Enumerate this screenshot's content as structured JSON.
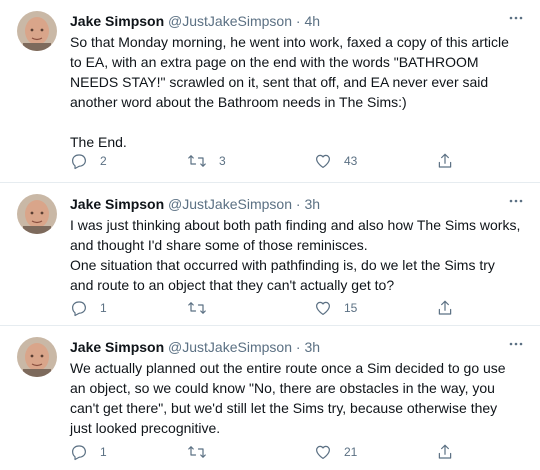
{
  "tweets": [
    {
      "name": "Jake Simpson",
      "handle": "@JustJakeSimpson",
      "sep": "·",
      "time": "4h",
      "paragraphs": [
        "So that Monday morning, he went into work, faxed a copy of this article to EA, with an extra page on the end with the words \"BATHROOM NEEDS STAY!\" scrawled on it, sent that off, and EA never ever said another word about the Bathroom needs in The Sims:)",
        "The End."
      ],
      "replies": "2",
      "retweets": "3",
      "likes": "43"
    },
    {
      "name": "Jake Simpson",
      "handle": "@JustJakeSimpson",
      "sep": "·",
      "time": "3h",
      "paragraphs": [
        "I was just thinking about both path finding and also how The Sims works, and thought I'd share some of those reminisces.",
        "One situation that occurred with pathfinding is, do we let the Sims try and route to an object that they can't actually get to?"
      ],
      "replies": "1",
      "retweets": "",
      "likes": "15"
    },
    {
      "name": "Jake Simpson",
      "handle": "@JustJakeSimpson",
      "sep": "·",
      "time": "3h",
      "paragraphs": [
        "We actually planned out the entire route once a Sim decided to go use an object, so we could know \"No, there are obstacles in the way, you can't get there\", but we'd still let the Sims try, because otherwise they just looked precognitive."
      ],
      "replies": "1",
      "retweets": "",
      "likes": "21"
    }
  ],
  "icons": {
    "reply": "reply-icon",
    "retweet": "retweet-icon",
    "like": "like-icon",
    "share": "share-icon",
    "more": "more-icon"
  },
  "colors": {
    "secondary_text": "#5b7083",
    "primary_text": "#0f1419",
    "divider": "#e6ecf0"
  }
}
